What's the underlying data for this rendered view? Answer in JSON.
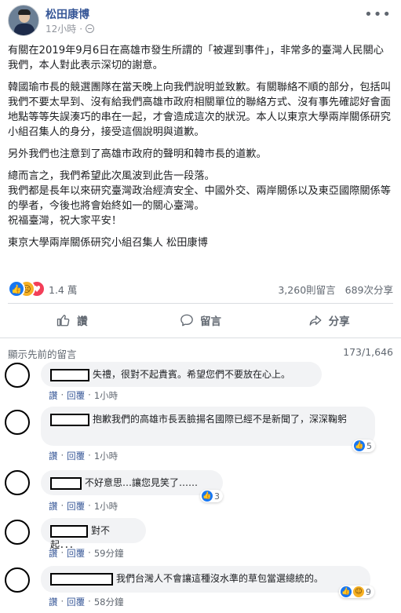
{
  "post": {
    "author": "松田康博",
    "time": "12小時",
    "paragraphs": [
      "有關在2019年9月6日在高雄市發生所謂的「被遲到事件」，非常多的臺灣人民關心我們，本人對此表示深切的謝意。",
      "韓國瑜市長的競選團隊在當天晚上向我們說明並致歉。有關聯絡不順的部分，包括叫我們不要太早到、沒有給我們高雄市政府相關單位的聯絡方式、沒有事先確認好會面地點等等失誤湊巧的串在一起，才會造成這次的狀況。本人以東京大學兩岸關係研究小組召集人的身分，接受這個說明與道歉。",
      "另外我們也注意到了高雄市政府的聲明和韓市長的道歉。",
      "總而言之，我們希望此次風波到此告一段落。",
      "我們都是長年以來研究臺灣政治經濟安全、中國外交、兩岸關係以及東亞國際關係等的學者，今後也將會始終如一的關心臺灣。",
      "祝福臺灣，祝大家平安！",
      "東京大學兩岸關係研究小組召集人 松田康博"
    ]
  },
  "reactions": {
    "count": "1.4 萬",
    "comments": "3,260則留言",
    "shares": "689次分享",
    "icons": [
      "like-icon",
      "sad-icon",
      "love-icon"
    ]
  },
  "actions": {
    "like": "讚",
    "comment": "留言",
    "share": "分享"
  },
  "comments_section": {
    "show_previous": "顯示先前的留言",
    "count": "173/1,646",
    "reply_label": "回覆",
    "like_label": "讚",
    "items": [
      {
        "text": "失禮，很對不起貴賓。希望您們不要放在心上。",
        "time": "1小時",
        "reactions": ""
      },
      {
        "text": "抱歉我們的高雄市長丟臉揚名國際已經不是新聞了，深深鞠躬",
        "time": "1小時",
        "reactions": "5"
      },
      {
        "text": "不好意思…讓您見笑了……",
        "time": "1小時",
        "reactions": "3"
      },
      {
        "text": "對不起．．．",
        "time": "59分鐘",
        "reactions": ""
      },
      {
        "text": "我們台灣人不會讓這種沒水準的草包當選總統的。",
        "time": "58分鐘",
        "reactions": "9"
      }
    ]
  },
  "colors": {
    "link": "#385898",
    "like": "#1877f2",
    "love": "#f33e58",
    "sad": "#f7b125",
    "muted": "#606770"
  }
}
